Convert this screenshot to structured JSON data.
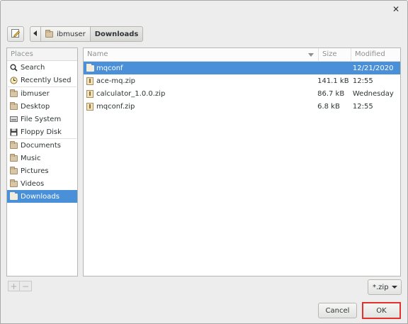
{
  "dialog": {
    "close_icon": "close-icon"
  },
  "pathbar": {
    "crumbs": [
      "ibmuser",
      "Downloads"
    ]
  },
  "places": {
    "header": "Places",
    "items": [
      {
        "label": "Search",
        "icon": "search-icon"
      },
      {
        "label": "Recently Used",
        "icon": "clock-icon"
      },
      {
        "label": "ibmuser",
        "icon": "folder-icon"
      },
      {
        "label": "Desktop",
        "icon": "folder-icon"
      },
      {
        "label": "File System",
        "icon": "drive-icon"
      },
      {
        "label": "Floppy Disk",
        "icon": "floppy-icon"
      },
      {
        "label": "Documents",
        "icon": "folder-icon"
      },
      {
        "label": "Music",
        "icon": "folder-icon"
      },
      {
        "label": "Pictures",
        "icon": "folder-icon"
      },
      {
        "label": "Videos",
        "icon": "folder-icon"
      },
      {
        "label": "Downloads",
        "icon": "folder-icon"
      }
    ],
    "selected": "Downloads",
    "add_symbol": "+",
    "remove_symbol": "−"
  },
  "files": {
    "columns": [
      "Name",
      "Size",
      "Modified"
    ],
    "rows": [
      {
        "name": "mqconf",
        "size": "",
        "modified": "12/21/2020",
        "type": "folder"
      },
      {
        "name": "ace-mq.zip",
        "size": "141.1 kB",
        "modified": "12:55",
        "type": "zip"
      },
      {
        "name": "calculator_1.0.0.zip",
        "size": "86.7 kB",
        "modified": "Wednesday",
        "type": "zip"
      },
      {
        "name": "mqconf.zip",
        "size": "6.8 kB",
        "modified": "12:55",
        "type": "zip"
      }
    ],
    "selected": "mqconf"
  },
  "filter": {
    "value": "*.zip"
  },
  "buttons": {
    "cancel": "Cancel",
    "ok": "OK"
  },
  "colors": {
    "selection": "#4a90d9",
    "highlight_border": "#e3322c"
  }
}
